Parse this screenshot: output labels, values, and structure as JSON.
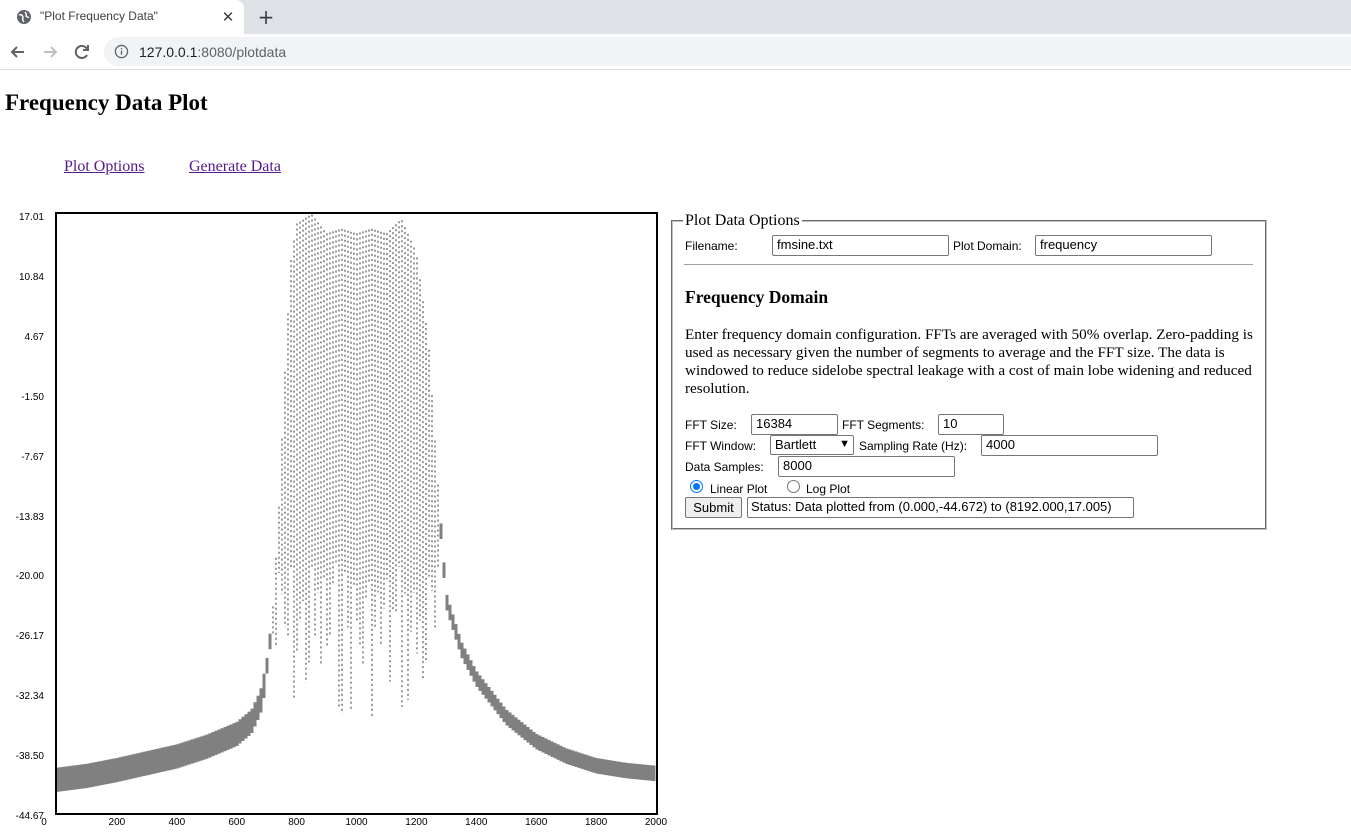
{
  "browser": {
    "tab_title": "\"Plot Frequency Data\"",
    "url_host": "127.0.0.1",
    "url_rest": ":8080/plotdata"
  },
  "page": {
    "title": "Frequency Data Plot",
    "links": [
      "Plot Options",
      "Generate Data"
    ]
  },
  "options": {
    "legend": "Plot Data Options",
    "filename_label": "Filename:",
    "filename_value": "fmsine.txt",
    "domain_label": "Plot Domain:",
    "domain_value": "frequency",
    "section_title": "Frequency Domain",
    "description": "Enter frequency domain configuration. FFTs are averaged with 50% overlap. Zero-padding is used as necessary given the number of segments to average and the FFT size. The data is windowed to reduce sidelobe spectral leakage with a cost of main lobe widening and reduced resolution.",
    "fft_size_label": "FFT Size:",
    "fft_size_value": "16384",
    "fft_segments_label": "FFT Segments:",
    "fft_segments_value": "10",
    "fft_window_label": "FFT Window:",
    "fft_window_value": "Bartlett",
    "sampling_rate_label": "Sampling Rate (Hz):",
    "sampling_rate_value": "4000",
    "data_samples_label": "Data Samples:",
    "data_samples_value": "8000",
    "radio_linear": "Linear Plot",
    "radio_log": "Log Plot",
    "radio_selected": "linear",
    "submit_label": "Submit",
    "status": "Status: Data plotted from (0.000,-44.672) to (8192.000,17.005)"
  },
  "chart_data": {
    "type": "scatter",
    "title": "",
    "xlabel": "",
    "ylabel": "",
    "xlim": [
      0,
      2000
    ],
    "ylim": [
      -44.67,
      17.01
    ],
    "x_ticks": [
      "0",
      "200",
      "400",
      "600",
      "800",
      "1000",
      "1200",
      "1400",
      "1600",
      "1800",
      "2000"
    ],
    "y_ticks": [
      "17.01",
      "10.84",
      "4.67",
      "-1.50",
      "-7.67",
      "-13.83",
      "-20.00",
      "-26.17",
      "-32.34",
      "-38.50",
      "-44.67"
    ],
    "marker_color": "#808080",
    "series": [
      {
        "values": [
          [
            0,
            -40.0
          ],
          [
            100,
            -39.6
          ],
          [
            200,
            -39.0
          ],
          [
            300,
            -38.3
          ],
          [
            400,
            -37.6
          ],
          [
            500,
            -36.6
          ],
          [
            600,
            -35.3
          ],
          [
            650,
            -34.0
          ],
          [
            680,
            -32.0
          ],
          [
            700,
            -29.0
          ],
          [
            720,
            -24.0
          ],
          [
            740,
            -14.0
          ],
          [
            760,
            0.0
          ],
          [
            780,
            12.0
          ],
          [
            800,
            16.0
          ],
          [
            850,
            17.0
          ],
          [
            900,
            15.0
          ],
          [
            950,
            15.5
          ],
          [
            1000,
            15.0
          ],
          [
            1050,
            15.5
          ],
          [
            1100,
            15.0
          ],
          [
            1150,
            16.5
          ],
          [
            1200,
            13.0
          ],
          [
            1240,
            4.0
          ],
          [
            1270,
            -10.0
          ],
          [
            1300,
            -22.0
          ],
          [
            1350,
            -27.0
          ],
          [
            1400,
            -30.0
          ],
          [
            1500,
            -34.0
          ],
          [
            1600,
            -36.5
          ],
          [
            1700,
            -38.0
          ],
          [
            1800,
            -39.0
          ],
          [
            1900,
            -39.5
          ],
          [
            2000,
            -39.8
          ]
        ]
      }
    ]
  }
}
